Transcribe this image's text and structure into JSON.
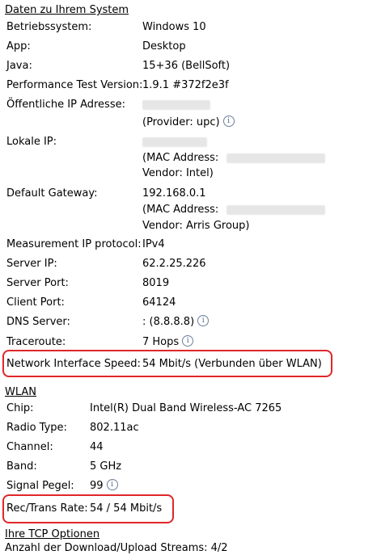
{
  "system_section": {
    "title": "Daten zu Ihrem System",
    "rows": {
      "os": {
        "label": "Betriebssystem:",
        "value": "Windows 10"
      },
      "app": {
        "label": "App:",
        "value": "Desktop"
      },
      "java": {
        "label": "Java:",
        "value": "15+36 (BellSoft)"
      },
      "perf": {
        "label": "Performance Test Version:",
        "value": "1.9.1 #372f2e3f"
      },
      "public_ip": {
        "label": "Öffentliche IP Adresse:",
        "provider": "(Provider: upc)"
      },
      "local_ip": {
        "label": "Lokale IP:",
        "mac_prefix": "(MAC Address:",
        "vendor": "Vendor: Intel)"
      },
      "gateway": {
        "label": "Default Gateway:",
        "value": "192.168.0.1",
        "mac_prefix": "(MAC Address:",
        "vendor": "Vendor: Arris Group)"
      },
      "protocol": {
        "label": "Measurement IP protocol:",
        "value": "IPv4"
      },
      "server_ip": {
        "label": "Server IP:",
        "value": "62.2.25.226"
      },
      "server_port": {
        "label": "Server Port:",
        "value": "8019"
      },
      "client_port": {
        "label": "Client Port:",
        "value": "64124"
      },
      "dns": {
        "label": "DNS Server:",
        "value": ": (8.8.8.8)"
      },
      "traceroute": {
        "label": "Traceroute:",
        "value": "7 Hops"
      },
      "nis": {
        "label": "Network Interface Speed:",
        "value": "54 Mbit/s (Verbunden über WLAN)"
      }
    }
  },
  "wlan_section": {
    "title": "WLAN",
    "rows": {
      "chip": {
        "label": "Chip:",
        "value": "Intel(R) Dual Band Wireless-AC 7265"
      },
      "radio": {
        "label": "Radio Type:",
        "value": "802.11ac"
      },
      "channel": {
        "label": "Channel:",
        "value": "44"
      },
      "band": {
        "label": "Band:",
        "value": "5 GHz"
      },
      "signal": {
        "label": "Signal Pegel:",
        "value": "99"
      },
      "rate": {
        "label": "Rec/Trans Rate:",
        "value": "54 / 54 Mbit/s"
      }
    }
  },
  "tcp_section": {
    "title": "Ihre TCP Optionen",
    "streams": "Anzahl der Download/Upload Streams: 4/2"
  },
  "info_glyph": "i",
  "colors": {
    "highlight": "#e0262a",
    "info_icon": "#4d6288"
  }
}
